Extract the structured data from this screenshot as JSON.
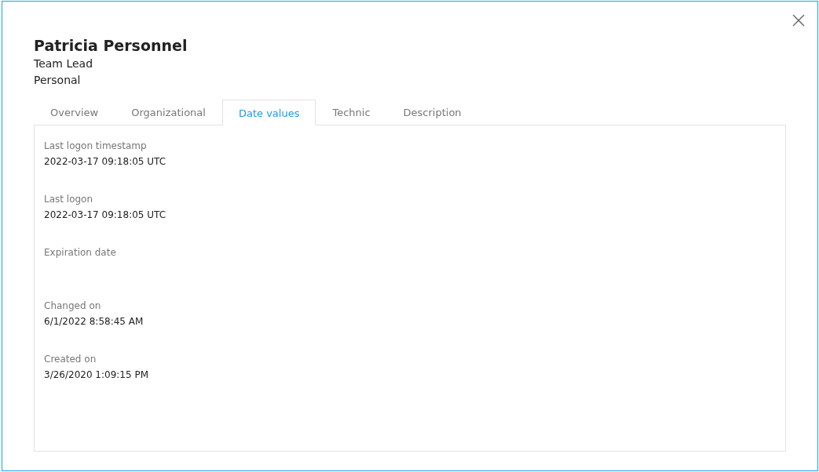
{
  "dialog": {
    "name": "Patricia Personnel",
    "job_title": "Team Lead",
    "type": "Personal"
  },
  "tabs": [
    {
      "label": "Overview",
      "selected": false
    },
    {
      "label": "Organizational",
      "selected": false
    },
    {
      "label": "Date values",
      "selected": true
    },
    {
      "label": "Technic",
      "selected": false
    },
    {
      "label": "Description",
      "selected": false
    }
  ],
  "fields": [
    {
      "label": "Last logon timestamp",
      "value": "2022-03-17 09:18:05 UTC"
    },
    {
      "label": "Last logon",
      "value": "2022-03-17 09:18:05 UTC"
    },
    {
      "label": "Expiration date"
    },
    {
      "label": "Changed on",
      "value": "6/1/2022 8:58:45 AM"
    },
    {
      "label": "Created on",
      "value": "3/26/2020 1:09:15 PM"
    }
  ]
}
